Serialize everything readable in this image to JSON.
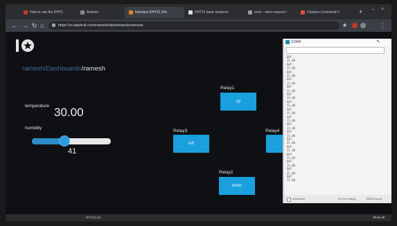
{
  "browser": {
    "tabs": [
      {
        "label": "How to use the DHT1",
        "color": "#c0392b"
      },
      {
        "label": "Arduino",
        "color": "#888888"
      },
      {
        "label": "Interface DHT11 (Hu",
        "color": "#e67e22"
      },
      {
        "label": "DHT11 basic tempera",
        "color": "#dddddd"
      },
      {
        "label": "error - stem request f",
        "color": "#999999"
      },
      {
        "label": "Catalyst Command C",
        "color": "#e74c3c"
      }
    ],
    "new_tab": "+",
    "url": "https://io.adafruit.com/ramesh/dashboards/ramesh"
  },
  "breadcrumb": {
    "part1": "ramesh",
    "sep1": "/",
    "part2": "Dashboards",
    "sep2": "/",
    "current": "ramesh"
  },
  "temperature": {
    "label": "temperature",
    "value": "30.00"
  },
  "humidity": {
    "label": "humidity",
    "value": "41",
    "level": 0.41
  },
  "relays": [
    {
      "label": "Relay1",
      "button": "up"
    },
    {
      "label": "Relay3",
      "button": "left"
    },
    {
      "label": "Relay4",
      "button": ""
    },
    {
      "label": "Relay2",
      "button": "down"
    }
  ],
  "serial": {
    "title": "COM4",
    "lines": [
      "DHT",
      "31.00",
      "DHT",
      "31.00",
      "DHT",
      "31.00",
      "DHT",
      "31.00",
      "DHT",
      "31.00",
      "DHT",
      "31.00",
      "DHT",
      "31.00",
      "DHT",
      "31.00",
      "DHT",
      "31.00",
      "DHT",
      "31.00",
      "DHT",
      "31.00",
      "DHT",
      "31.00",
      "DHT",
      "31.00",
      "DHT",
      "31.00",
      "DHT",
      "31.00",
      "DHT",
      "31.00",
      "DHT",
      "31.00"
    ],
    "autoscroll": "Autoscroll",
    "line_ending": "No line ending",
    "baud": "115200 baud"
  },
  "taskbar": {
    "downloads": [
      "",
      "DHT(4).zip"
    ],
    "show_all": "Show all"
  }
}
